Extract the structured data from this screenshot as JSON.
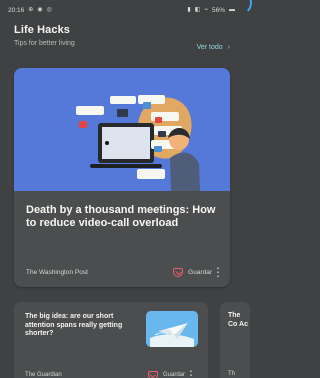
{
  "status_bar": {
    "time": "20:16",
    "left_icons": [
      "notification-icon",
      "music-icon",
      "settings-icon"
    ],
    "right_text": "56%",
    "right_icons": [
      "battery-saver-icon",
      "sim-icon",
      "signal-icon",
      "battery-icon"
    ]
  },
  "section": {
    "title": "Life Hacks",
    "subtitle": "Tips for better living",
    "see_all_label": "Ver todo"
  },
  "featured": {
    "headline": "Death by a thousand meetings: How to reduce video-call overload",
    "source": "The Washington Post",
    "save_label": "Guardar",
    "colors": {
      "image_background": "#5479d8",
      "save_accent": "#ee5f6b"
    }
  },
  "cards": [
    {
      "headline": "The big idea: are our short attention spans really getting shorter?",
      "source": "The Guardian",
      "save_label": "Guardar"
    },
    {
      "headline": "The Co Ac",
      "source": "Th"
    }
  ]
}
